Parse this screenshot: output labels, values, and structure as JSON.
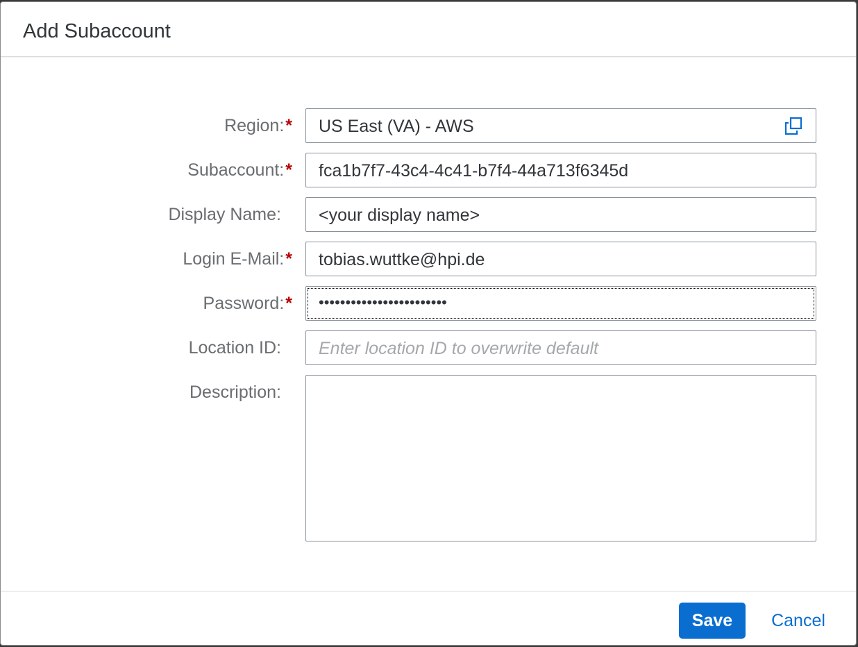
{
  "dialog": {
    "title": "Add Subaccount"
  },
  "form": {
    "region": {
      "label": "Region:",
      "required": "*",
      "value": "US East (VA) - AWS"
    },
    "subaccount": {
      "label": "Subaccount:",
      "required": "*",
      "value": "fca1b7f7-43c4-4c41-b7f4-44a713f6345d"
    },
    "display_name": {
      "label": "Display Name:",
      "value": "<your display name>"
    },
    "login_email": {
      "label": "Login E-Mail:",
      "required": "*",
      "value": "tobias.wuttke@hpi.de"
    },
    "password": {
      "label": "Password:",
      "required": "*",
      "masked_value": "••••••••••••••••••••••••"
    },
    "location_id": {
      "label": "Location ID:",
      "placeholder": "Enter location ID to overwrite default"
    },
    "description": {
      "label": "Description:",
      "value": ""
    }
  },
  "footer": {
    "save_label": "Save",
    "cancel_label": "Cancel"
  },
  "colors": {
    "accent": "#0a6ed1",
    "required": "#bb0000",
    "label": "#6a6d70",
    "text": "#32363a"
  },
  "icons": {
    "region_value_help": "value-help-icon"
  }
}
